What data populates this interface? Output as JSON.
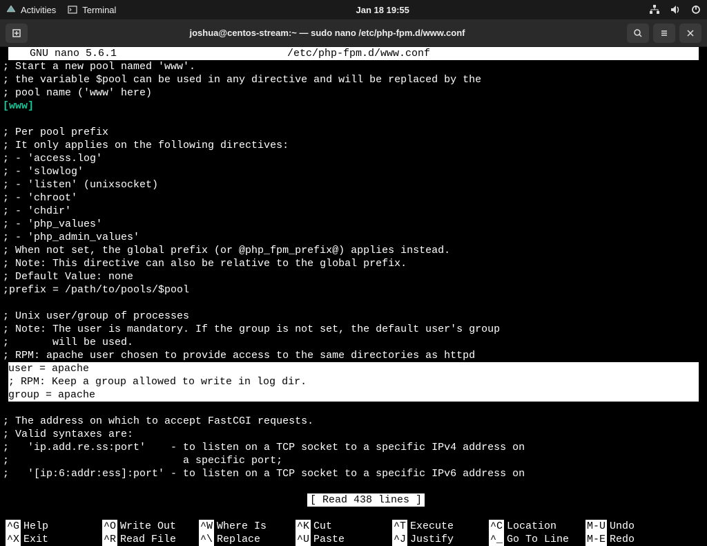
{
  "topbar": {
    "activities": "Activities",
    "terminal": "Terminal",
    "clock": "Jan 18  19:55"
  },
  "window": {
    "title": "joshua@centos-stream:~ — sudo nano /etc/php-fpm.d/www.conf"
  },
  "nano": {
    "app": " GNU nano 5.6.1",
    "file": "/etc/php-fpm.d/www.conf",
    "lines": [
      "; Start a new pool named 'www'.",
      "; the variable $pool can be used in any directive and will be replaced by the",
      "; pool name ('www' here)"
    ],
    "section": "[www]",
    "lines2": [
      "",
      "; Per pool prefix",
      "; It only applies on the following directives:",
      "; - 'access.log'",
      "; - 'slowlog'",
      "; - 'listen' (unixsocket)",
      "; - 'chroot'",
      "; - 'chdir'",
      "; - 'php_values'",
      "; - 'php_admin_values'",
      "; When not set, the global prefix (or @php_fpm_prefix@) applies instead.",
      "; Note: This directive can also be relative to the global prefix.",
      "; Default Value: none",
      ";prefix = /path/to/pools/$pool",
      "",
      "; Unix user/group of processes",
      "; Note: The user is mandatory. If the group is not set, the default user's group",
      ";       will be used.",
      "; RPM: apache user chosen to provide access to the same directories as httpd"
    ],
    "highlight": [
      "user = apache",
      "; RPM: Keep a group allowed to write in log dir.",
      "group = apache"
    ],
    "lines3": [
      "",
      "; The address on which to accept FastCGI requests.",
      "; Valid syntaxes are:",
      ";   'ip.add.re.ss:port'    - to listen on a TCP socket to a specific IPv4 address on",
      ";                            a specific port;",
      ";   '[ip:6:addr:ess]:port' - to listen on a TCP socket to a specific IPv6 address on"
    ],
    "status": "[ Read 438 lines ]",
    "shortcuts": [
      {
        "k": "^G",
        "l": "Help"
      },
      {
        "k": "^O",
        "l": "Write Out"
      },
      {
        "k": "^W",
        "l": "Where Is"
      },
      {
        "k": "^K",
        "l": "Cut"
      },
      {
        "k": "^T",
        "l": "Execute"
      },
      {
        "k": "^C",
        "l": "Location"
      },
      {
        "k": "M-U",
        "l": "Undo"
      },
      {
        "k": "^X",
        "l": "Exit"
      },
      {
        "k": "^R",
        "l": "Read File"
      },
      {
        "k": "^\\",
        "l": "Replace"
      },
      {
        "k": "^U",
        "l": "Paste"
      },
      {
        "k": "^J",
        "l": "Justify"
      },
      {
        "k": "^_",
        "l": "Go To Line"
      },
      {
        "k": "M-E",
        "l": "Redo"
      }
    ]
  }
}
